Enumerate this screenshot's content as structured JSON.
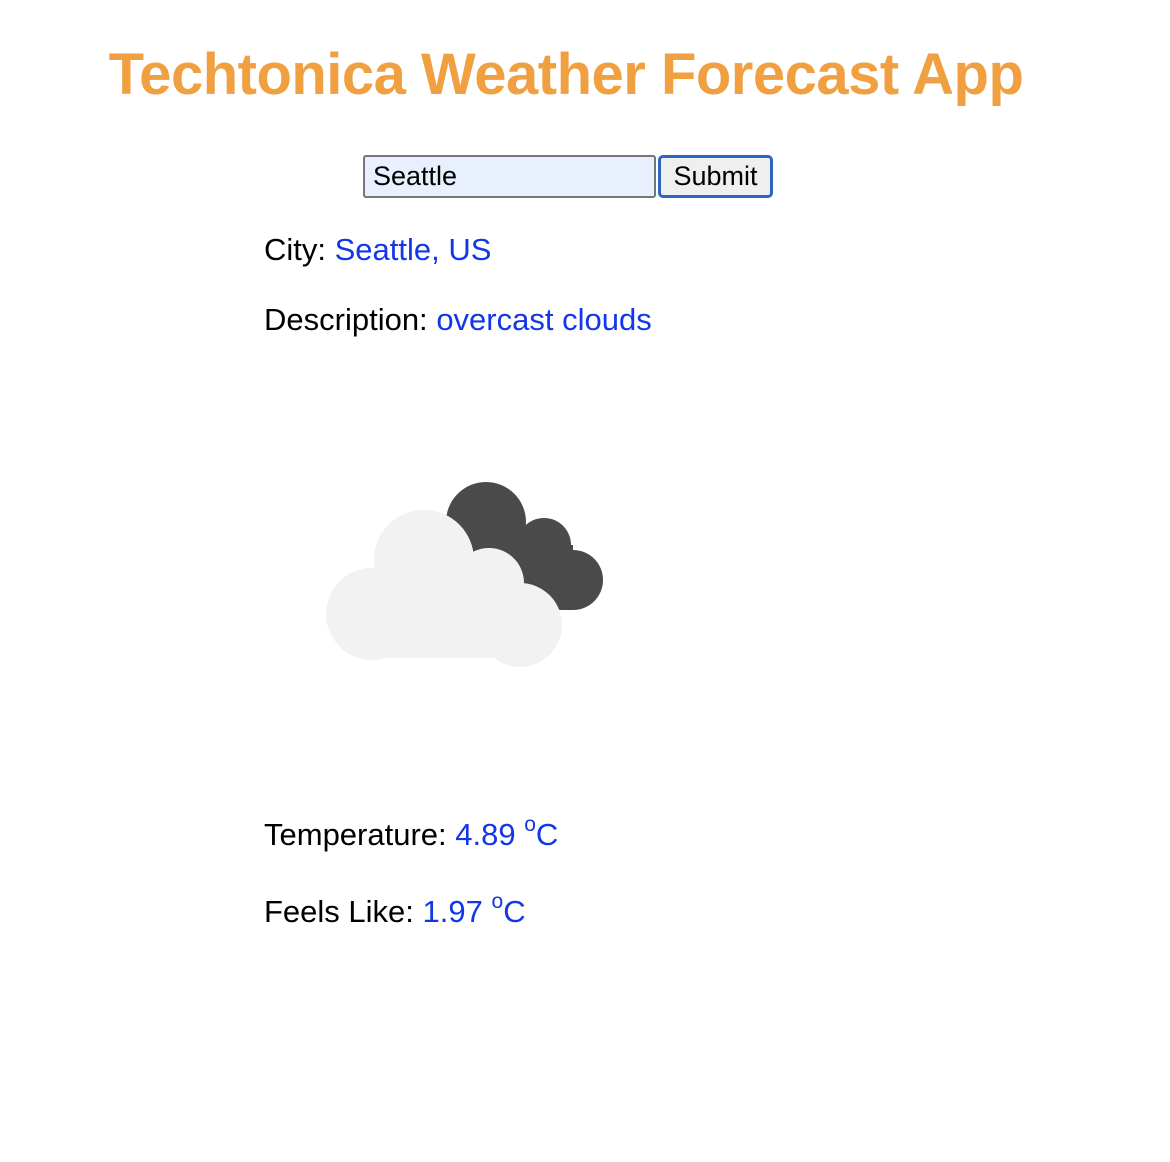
{
  "header": {
    "title": "Techtonica Weather Forecast App",
    "title_color": "#f0a040"
  },
  "search": {
    "value": "Seattle",
    "input_background": "#e8f0fe",
    "submit_label": "Submit"
  },
  "weather": {
    "city_label": "City:",
    "city_value": "Seattle, US",
    "description_label": "Description:",
    "description_value": "overcast clouds",
    "icon": "overcast-clouds-icon",
    "temperature_label": "Temperature:",
    "temperature_value": "4.89",
    "temperature_degree": "o",
    "temperature_unit": "C",
    "feels_like_label": "Feels Like:",
    "feels_like_value": "1.97",
    "feels_like_degree": "o",
    "feels_like_unit": "C",
    "value_color": "#1237e8"
  }
}
